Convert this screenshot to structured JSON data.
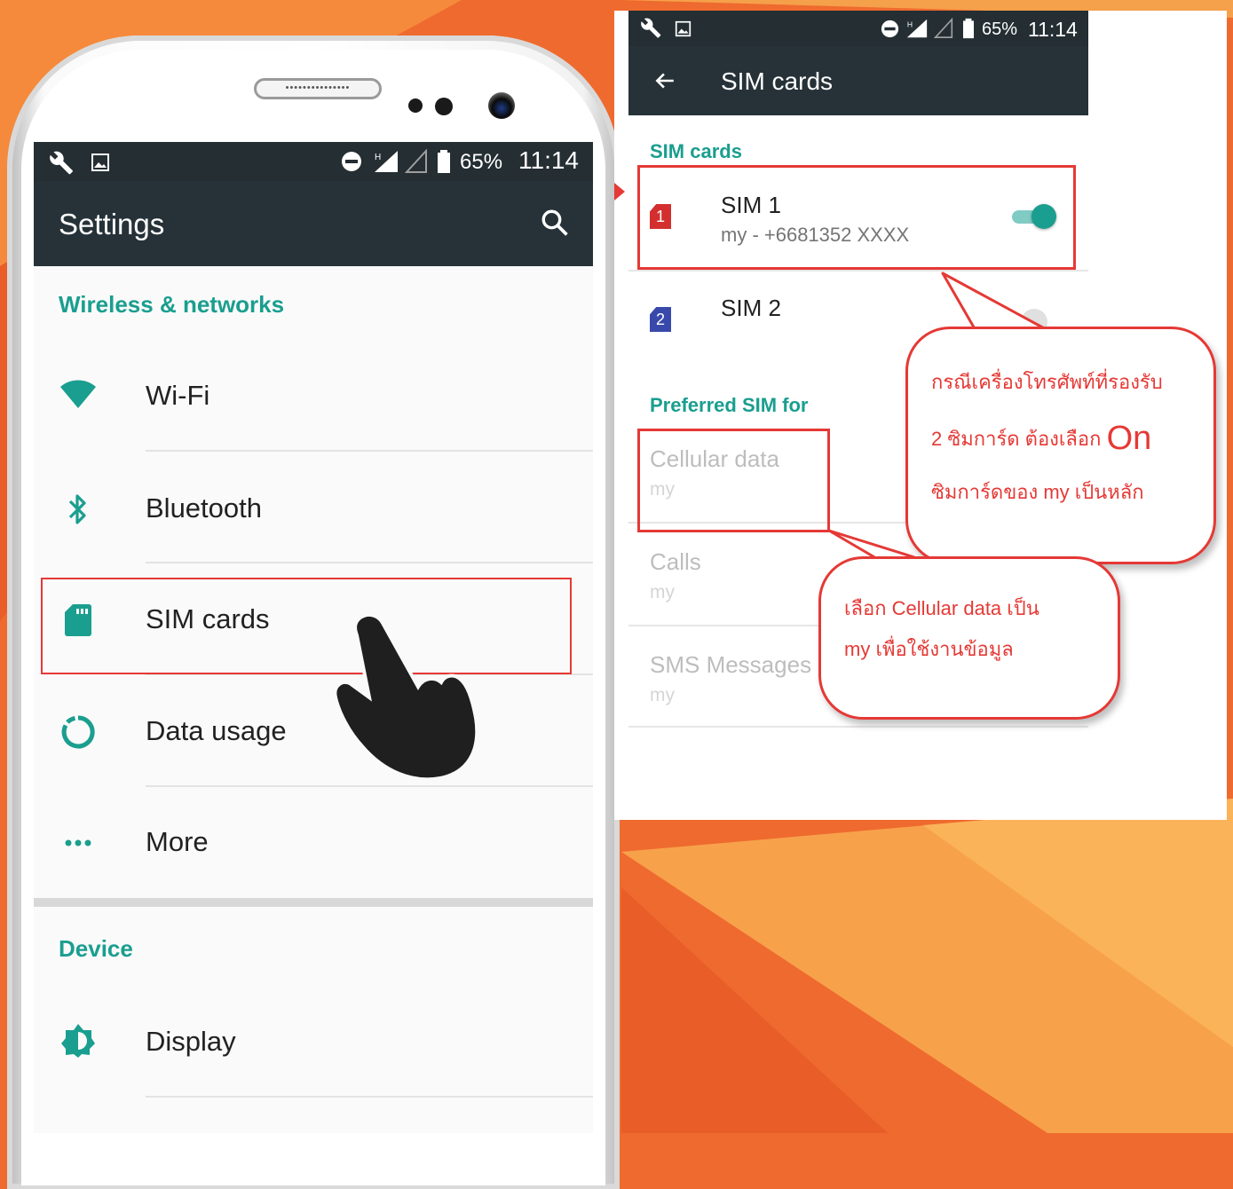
{
  "left_phone": {
    "speaker_label": "•••••••••••••••",
    "status": {
      "battery": "65%",
      "time": "11:14"
    },
    "appbar": {
      "title": "Settings"
    },
    "sections": {
      "wireless": "Wireless & networks",
      "device": "Device"
    },
    "rows": [
      {
        "label": "Wi-Fi",
        "icon": "wifi-icon"
      },
      {
        "label": "Bluetooth",
        "icon": "bluetooth-icon"
      },
      {
        "label": "SIM cards",
        "icon": "sim-card-icon"
      },
      {
        "label": "Data usage",
        "icon": "data-usage-icon"
      },
      {
        "label": "More",
        "icon": "more-icon"
      },
      {
        "label": "Display",
        "icon": "display-icon"
      }
    ]
  },
  "right_screen": {
    "status": {
      "battery": "65%",
      "time": "11:14"
    },
    "appbar": {
      "title": "SIM cards"
    },
    "section_sims": "SIM cards",
    "sim1": {
      "badge": "1",
      "name": "SIM 1",
      "number": "my - +6681352 XXXX",
      "enabled": true
    },
    "sim2": {
      "badge": "2",
      "name": "SIM 2"
    },
    "section_pref": "Preferred SIM for",
    "prefs": [
      {
        "title": "Cellular data",
        "value": "my"
      },
      {
        "title": "Calls",
        "value": "my"
      },
      {
        "title": "SMS Messages",
        "value": "my"
      }
    ]
  },
  "callouts": {
    "bubble1": {
      "line1": "กรณีเครื่องโทรศัพท์ที่รองรับ",
      "line2_prefix": "2 ซิมการ์ด ต้องเลือก",
      "line2_big": "On",
      "line3": "ซิมการ์ดของ my เป็นหลัก"
    },
    "bubble2": {
      "line1": "เลือก Cellular data เป็น",
      "line2": "my เพื่อใช้งานข้อมูล"
    }
  },
  "colors": {
    "accent": "#1a9e8f",
    "appbar": "#263238",
    "highlight": "#e53935",
    "background": "#ef6a2e"
  }
}
